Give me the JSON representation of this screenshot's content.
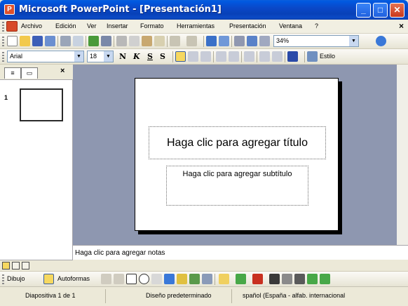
{
  "window": {
    "title": "Microsoft PowerPoint - [Presentación1]",
    "minimize_glyph": "_",
    "maximize_glyph": "□",
    "close_glyph": "✕"
  },
  "menu": {
    "items": [
      "Archivo",
      "Edición",
      "Ver",
      "Insertar",
      "Formato",
      "Herramientas",
      "Presentación",
      "Ventana",
      "?"
    ],
    "close_glyph": "×"
  },
  "standard_toolbar": {
    "zoom": "34%",
    "icons": [
      "new-icon",
      "open-icon",
      "save-icon",
      "permission-icon",
      "print-icon",
      "print-preview-icon",
      "spelling-icon",
      "research-icon",
      "cut-icon",
      "copy-icon",
      "paste-icon",
      "format-painter-icon",
      "undo-icon",
      "redo-icon",
      "chart-icon",
      "table-icon",
      "expand-icon",
      "grayscale-icon",
      "grid-icon",
      "help-icon"
    ]
  },
  "format_toolbar": {
    "font": "Arial",
    "size": "18",
    "bold": "N",
    "italic": "K",
    "underline": "S",
    "shadow": "S",
    "design": "Estilo"
  },
  "left_pane": {
    "close_glyph": "×",
    "slide_number": "1"
  },
  "slide": {
    "title_placeholder": "Haga clic para agregar título",
    "subtitle_placeholder": "Haga clic para agregar subtítulo"
  },
  "notes": {
    "placeholder": "Haga clic para agregar notas"
  },
  "draw_toolbar": {
    "draw": "Dibujo",
    "autoshapes": "Autoformas"
  },
  "status": {
    "slide": "Diapositiva 1 de 1",
    "design": "Diseño predeterminado",
    "language": "spañol (España - alfab. internacional"
  },
  "colors": {
    "titlebar": "#0841b8",
    "workspace": "#8e97b0",
    "app_accent": "#d84a28"
  }
}
